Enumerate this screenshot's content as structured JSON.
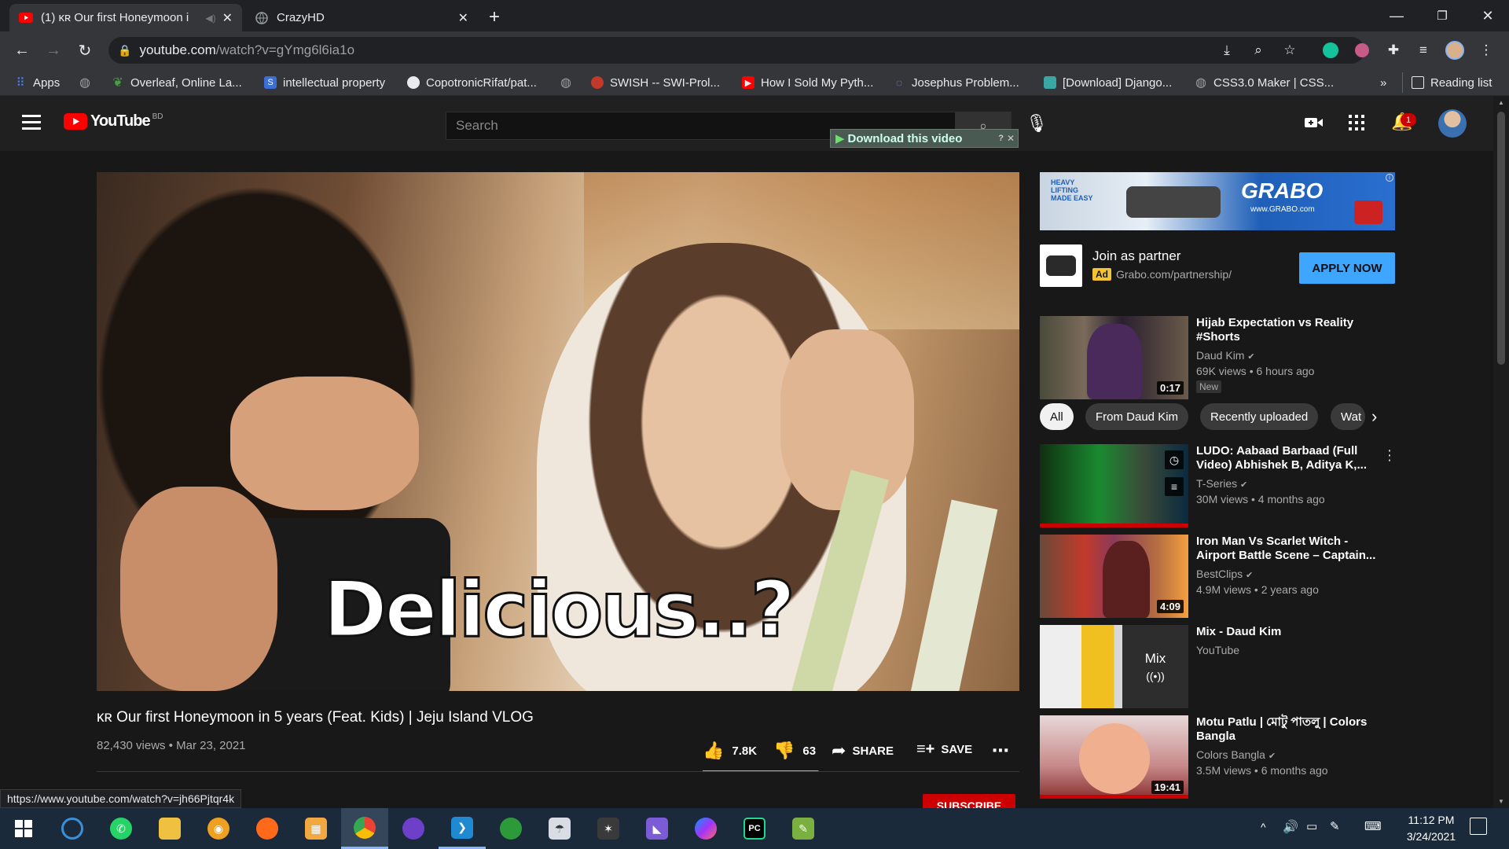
{
  "tabs": [
    {
      "title": "(1) ᴋʀ Our first Honeymoon i",
      "active": true
    },
    {
      "title": "CrazyHD",
      "active": false
    }
  ],
  "url": {
    "host": "youtube.com",
    "path": "/watch?v=gYmg6l6ia1o"
  },
  "bookmarks": [
    "Apps",
    "Overleaf, Online La...",
    "intellectual property",
    "CopotronicRifat/pat...",
    "SWISH -- SWI-Prol...",
    "How I Sold My Pyth...",
    "Josephus Problem...",
    "[Download] Django...",
    "CSS3.0 Maker | CSS...",
    "»",
    "Reading list"
  ],
  "yt": {
    "logo": "YouTube",
    "region": "BD",
    "search_placeholder": "Search",
    "download_label": "Download this video",
    "notif_count": "1"
  },
  "video": {
    "caption": "Delicious..?",
    "title": "ᴋʀ Our first Honeymoon in 5 years (Feat. Kids) | Jeju Island VLOG",
    "meta": "82,430 views • Mar 23, 2021",
    "likes": "7.8K",
    "dislikes": "63",
    "like_ratio": 0.992,
    "share": "SHARE",
    "save": "SAVE",
    "subscribe": "SUBSCRIBE"
  },
  "ad": {
    "banner_brand": "GRABO",
    "banner_tag": "HEAVY LIFTING MADE EASY",
    "banner_url": "www.GRABO.com",
    "title": "Join as partner",
    "badge": "Ad",
    "url": "Grabo.com/partnership/",
    "cta": "APPLY NOW"
  },
  "first_rec": {
    "title": "Hijab Expectation vs Reality #Shorts",
    "channel": "Daud Kim",
    "views": "69K views • 6 hours ago",
    "badge": "New",
    "duration": "0:17"
  },
  "chips": [
    "All",
    "From Daud Kim",
    "Recently uploaded",
    "Wat"
  ],
  "recs": [
    {
      "title": "LUDO: Aabaad Barbaad (Full Video) Abhishek B, Aditya K,...",
      "channel": "T-Series",
      "views": "30M views • 4 months ago",
      "duration": ""
    },
    {
      "title": "Iron Man Vs Scarlet Witch - Airport Battle Scene – Captain...",
      "channel": "BestClips",
      "views": "4.9M views • 2 years ago",
      "duration": "4:09"
    },
    {
      "title": "Mix - Daud Kim",
      "channel": "YouTube",
      "views": "",
      "duration": "",
      "mix_label": "Mix"
    },
    {
      "title": "Motu Patlu | মোটু পাতলু | Colors Bangla",
      "channel": "Colors Bangla",
      "views": "3.5M views • 6 months ago",
      "duration": "19:41"
    }
  ],
  "status_url": "https://www.youtube.com/watch?v=jh66Pjtqr4k",
  "clock": {
    "time": "11:12 PM",
    "date": "3/24/2021"
  }
}
